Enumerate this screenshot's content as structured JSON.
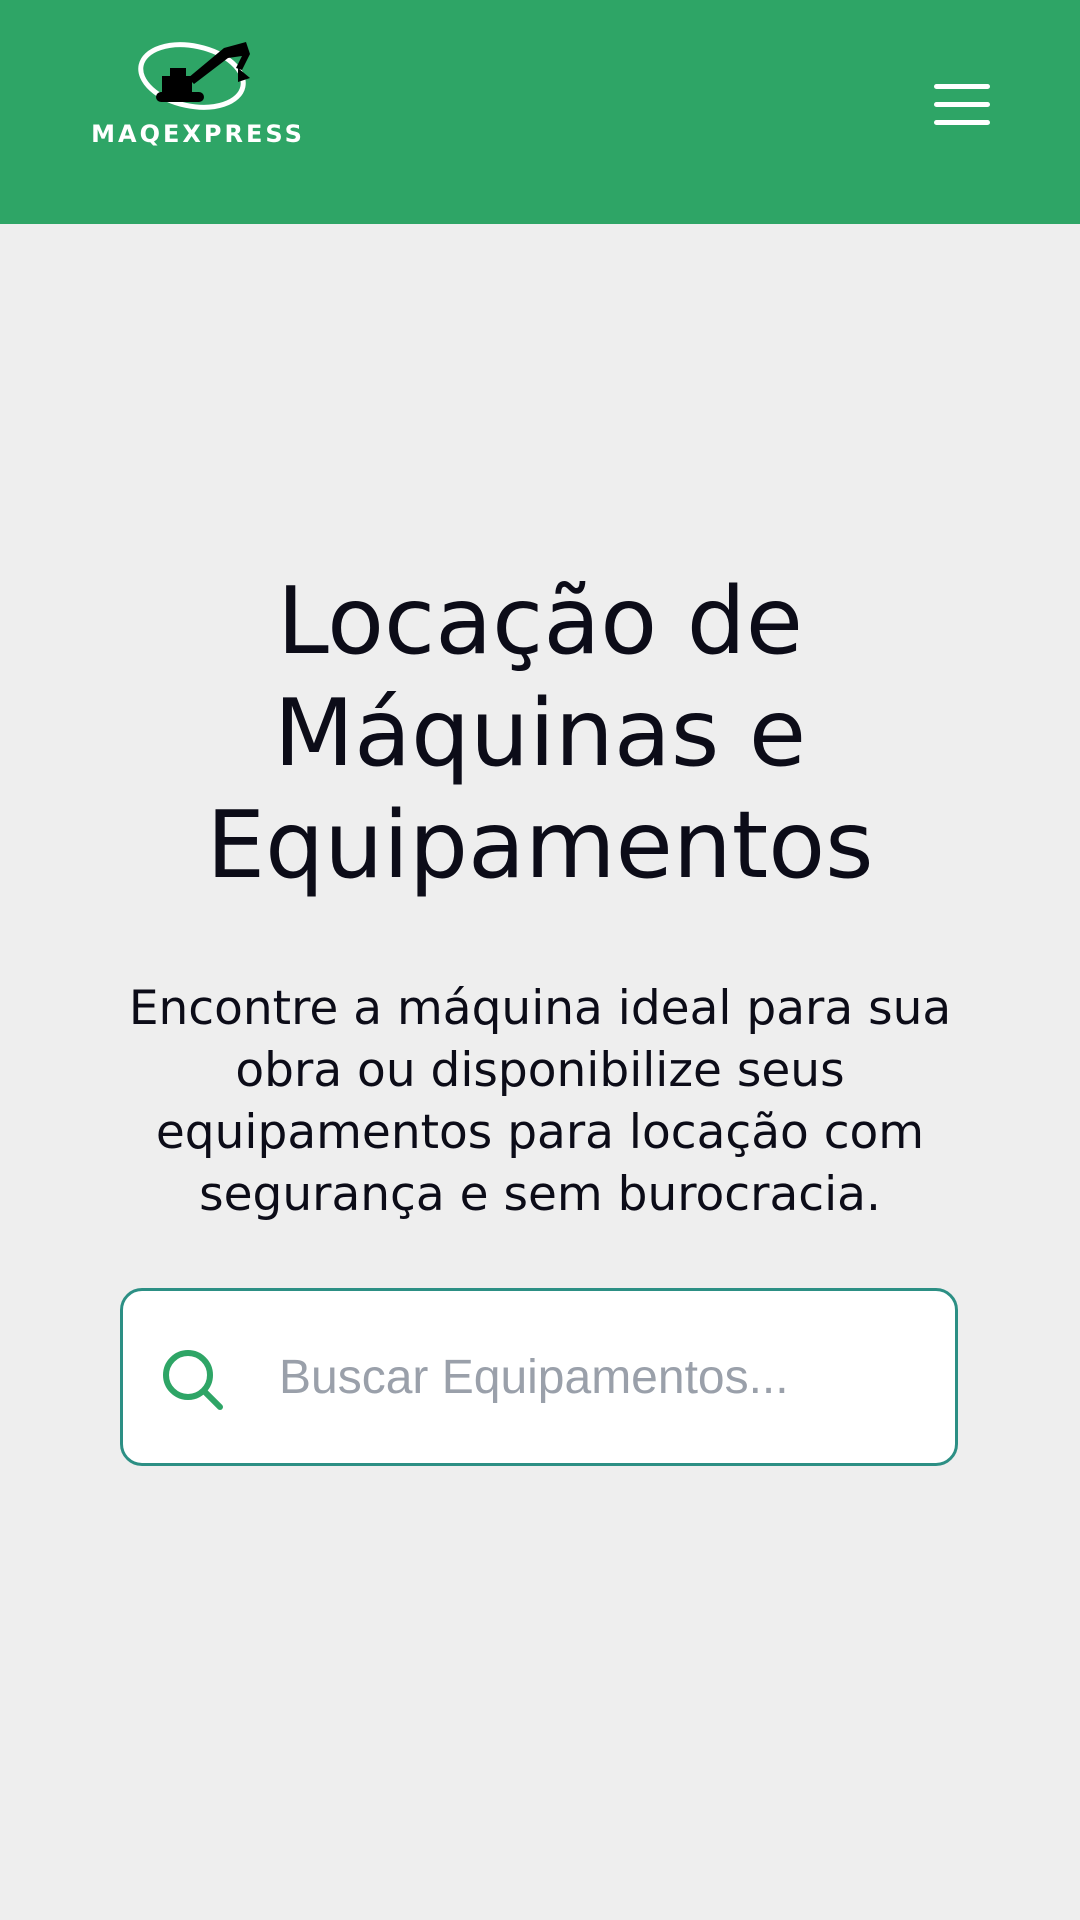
{
  "header": {
    "background_color": "#2ea566",
    "logo_text": "MAQEXPRESS",
    "logo_icon": "excavator-icon",
    "menu_icon": "hamburger-menu-icon"
  },
  "hero": {
    "title": "Locação de Máquinas e Equipamentos",
    "subtitle": "Encontre a máquina ideal para sua obra ou disponibilize seus equipamentos para locação com segurança e sem burocracia."
  },
  "search": {
    "placeholder": "Buscar Equipamentos...",
    "value": "",
    "icon": "search-icon",
    "border_color": "#2c8f84",
    "icon_color": "#2ea566"
  },
  "colors": {
    "page_background": "#eeeeee",
    "text": "#0c0c18",
    "placeholder": "#9aa0aa"
  }
}
